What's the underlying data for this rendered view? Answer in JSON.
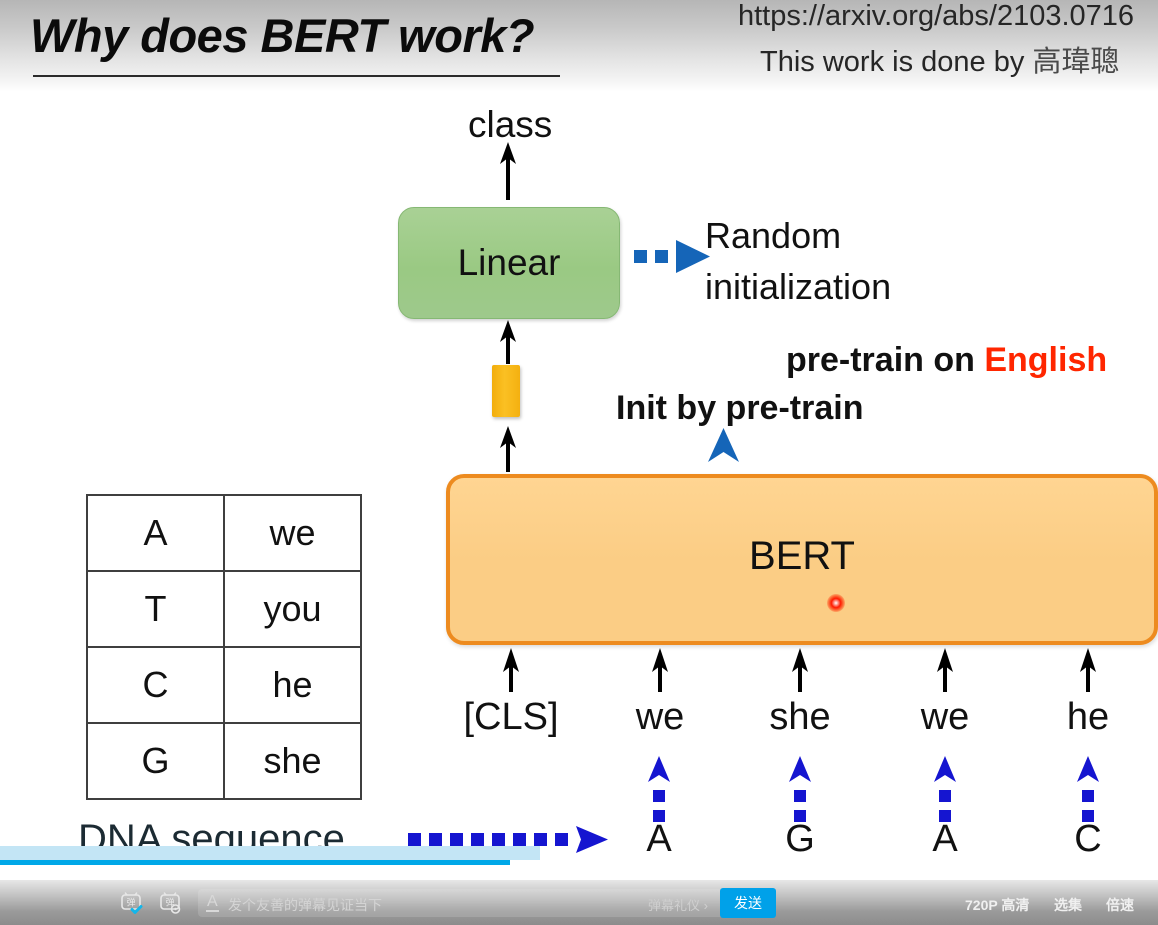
{
  "slide": {
    "title": "Why does BERT work?",
    "paper_url": "https://arxiv.org/abs/2103.0716",
    "credit_prefix": "This work is done by ",
    "credit_name": "高瑋聰"
  },
  "diagram": {
    "class_label": "class",
    "linear_box": "Linear",
    "bert_box": "BERT",
    "random_init_line1": "Random",
    "random_init_line2": "initialization",
    "pretrain_text": "pre-train on ",
    "pretrain_highlight": "English",
    "init_by_pretrain": "Init by pre-train",
    "dna_sequence_label": "DNA sequence",
    "tokens": [
      "[CLS]",
      "we",
      "she",
      "we",
      "he"
    ],
    "bases": [
      "A",
      "G",
      "A",
      "C"
    ],
    "colors": {
      "linear_box_fill": "#9ac983",
      "linear_box_border": "#86b874",
      "bert_box_fill": "#fbcd85",
      "bert_box_border": "#ed8b1f",
      "cls_vector_fill": "#f4b010",
      "blue_arrow": "#1565b8",
      "dark_blue_arrow": "#1515d0",
      "highlight_red": "#ff2600",
      "laser_dot": "#ff1a00"
    }
  },
  "mapping_table": {
    "rows": [
      {
        "base": "A",
        "word": "we"
      },
      {
        "base": "T",
        "word": "you"
      },
      {
        "base": "C",
        "word": "he"
      },
      {
        "base": "G",
        "word": "she"
      }
    ]
  },
  "player": {
    "danmaku_input_placeholder": "发个友善的弹幕见证当下",
    "etiquette_label": "弹幕礼仪 ›",
    "send_label": "发送",
    "quality_label": "720P 高清",
    "episodes_label": "选集",
    "speed_label": "倍速",
    "font_icon": "A",
    "progress_buffer_pct": 47,
    "progress_played_pct": 44
  }
}
